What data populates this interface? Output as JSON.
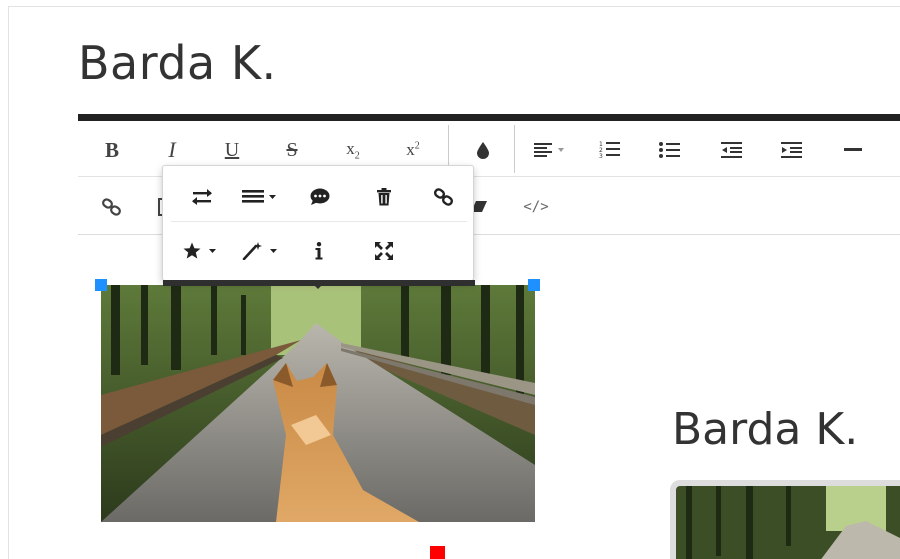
{
  "document": {
    "title": "Barda K."
  },
  "preview": {
    "title": "Barda K."
  },
  "toolbar": {
    "row1": {
      "bold": "B",
      "italic": "I",
      "underline": "U",
      "strikethrough": "S",
      "subscript_base": "x",
      "subscript_mark": "2",
      "superscript_base": "x",
      "superscript_mark": "2"
    },
    "row2": {
      "code_view": "</>"
    }
  },
  "icons": {
    "toolbar": [
      "bold-icon",
      "italic-icon",
      "underline-icon",
      "strikethrough-icon",
      "subscript-icon",
      "superscript-icon",
      "color-drop-icon",
      "align-icon",
      "ordered-list-icon",
      "unordered-list-icon",
      "outdent-icon",
      "indent-icon",
      "horizontal-rule-icon",
      "link-icon",
      "clear-format-icon",
      "code-view-icon"
    ],
    "popover": [
      "replace-icon",
      "display-icon",
      "caption-icon",
      "trash-icon",
      "link-icon",
      "star-icon",
      "magic-wand-icon",
      "info-icon",
      "fullscreen-icon"
    ]
  },
  "colors": {
    "editor_bar": "#222222",
    "selection_handle": "#1e90ff",
    "resize_handle": "#ff0000"
  }
}
